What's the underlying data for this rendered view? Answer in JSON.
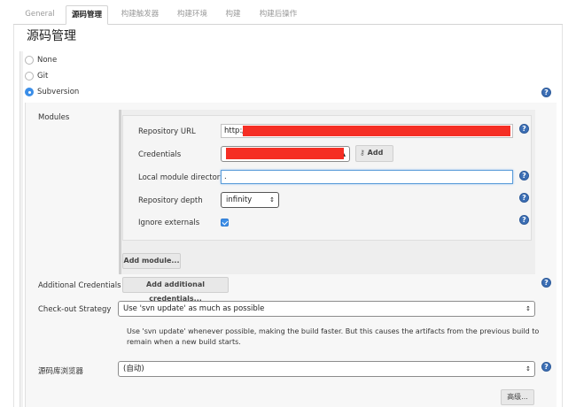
{
  "tabs": [
    {
      "label": "General",
      "active": false
    },
    {
      "label": "源码管理",
      "active": true
    },
    {
      "label": "构建触发器",
      "active": false
    },
    {
      "label": "构建环境",
      "active": false
    },
    {
      "label": "构建",
      "active": false
    },
    {
      "label": "构建后操作",
      "active": false
    }
  ],
  "page_title": "源码管理",
  "scm_options": [
    {
      "label": "None",
      "selected": false
    },
    {
      "label": "Git",
      "selected": false
    },
    {
      "label": "Subversion",
      "selected": true
    }
  ],
  "modules": {
    "section_label": "Modules",
    "repository_url": {
      "label": "Repository URL",
      "value": "http://"
    },
    "credentials": {
      "label": "Credentials",
      "add_label": "Add"
    },
    "local_module_directory": {
      "label": "Local module directory",
      "value": "."
    },
    "repository_depth": {
      "label": "Repository depth",
      "value": "infinity"
    },
    "ignore_externals": {
      "label": "Ignore externals",
      "checked": true
    },
    "add_module_label": "Add module..."
  },
  "additional_credentials": {
    "label": "Additional Credentials",
    "button_label": "Add additional credentials..."
  },
  "checkout_strategy": {
    "label": "Check-out Strategy",
    "value": "Use 'svn update' as much as possible",
    "description": "Use 'svn update' whenever possible, making the build faster. But this causes the artifacts from the previous build to remain when a new build starts."
  },
  "repo_browser": {
    "label": "源码库浏览器",
    "value": "(自动)"
  },
  "advanced_label": "高级...",
  "colors": {
    "accent": "#3b8ee8",
    "help": "#3c6fb5",
    "redaction": "#f52e24"
  }
}
